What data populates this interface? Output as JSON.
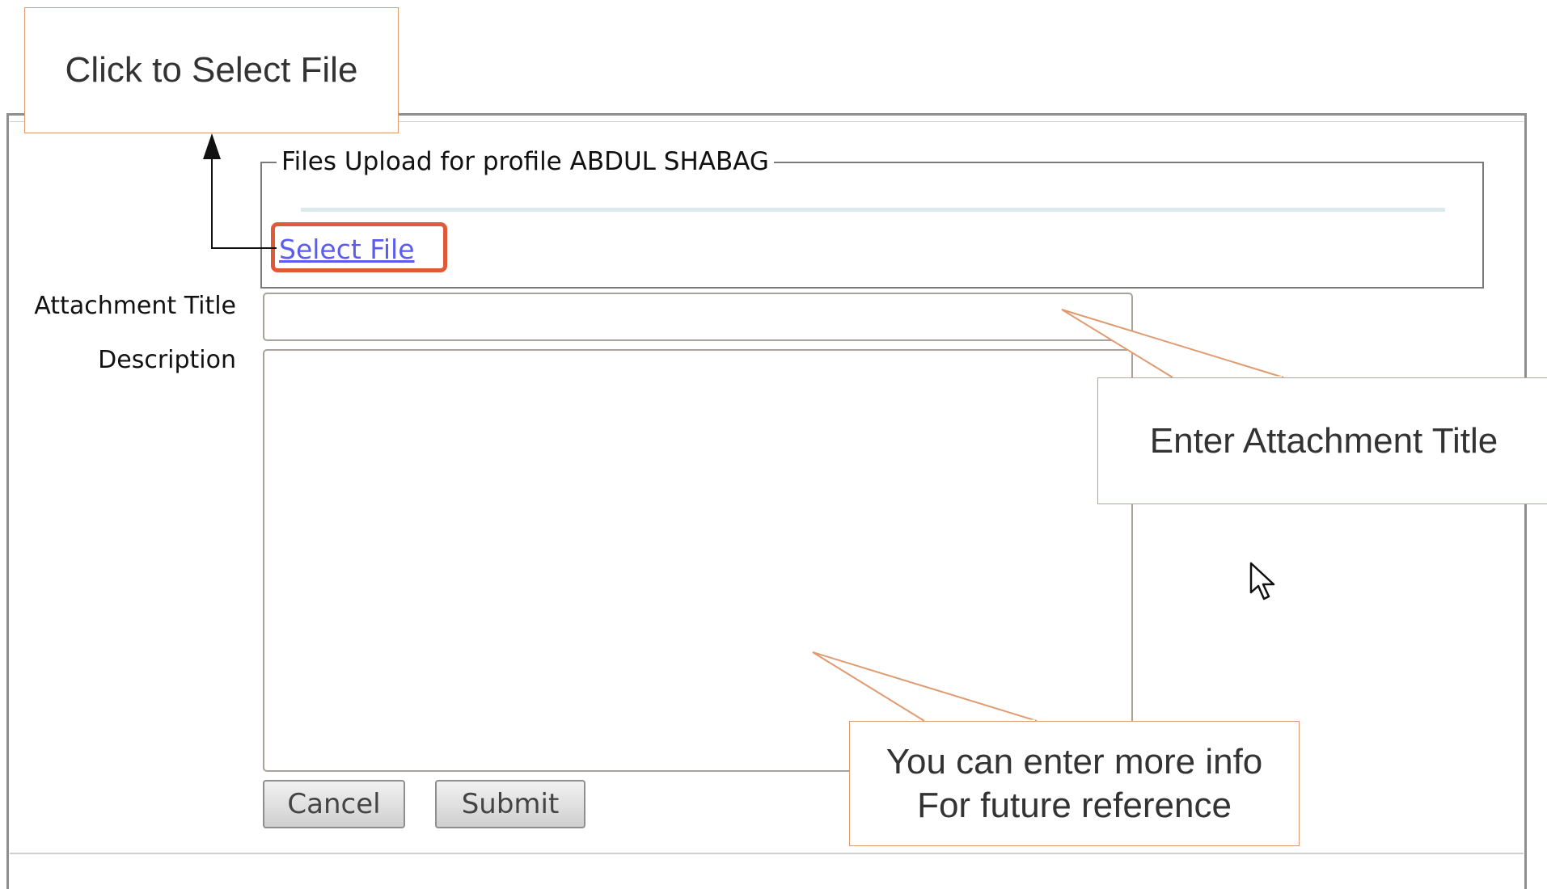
{
  "fieldset": {
    "legend": "Files Upload for profile ABDUL SHABAG",
    "select_file_label": "Select File"
  },
  "form": {
    "attachment_title_label": "Attachment Title",
    "attachment_title_value": "",
    "description_label": "Description",
    "description_value": "",
    "cancel_label": "Cancel",
    "submit_label": "Submit"
  },
  "callouts": {
    "select_file": "Click to Select File",
    "attachment_title": "Enter Attachment Title",
    "description_line1": "You can enter more info",
    "description_line2": "For future reference"
  },
  "colors": {
    "highlight": "#e05a3a",
    "callout_border": "#e09a70",
    "link": "#5b5bf0"
  },
  "icons": [
    "arrow-up-icon",
    "mouse-pointer-icon"
  ]
}
